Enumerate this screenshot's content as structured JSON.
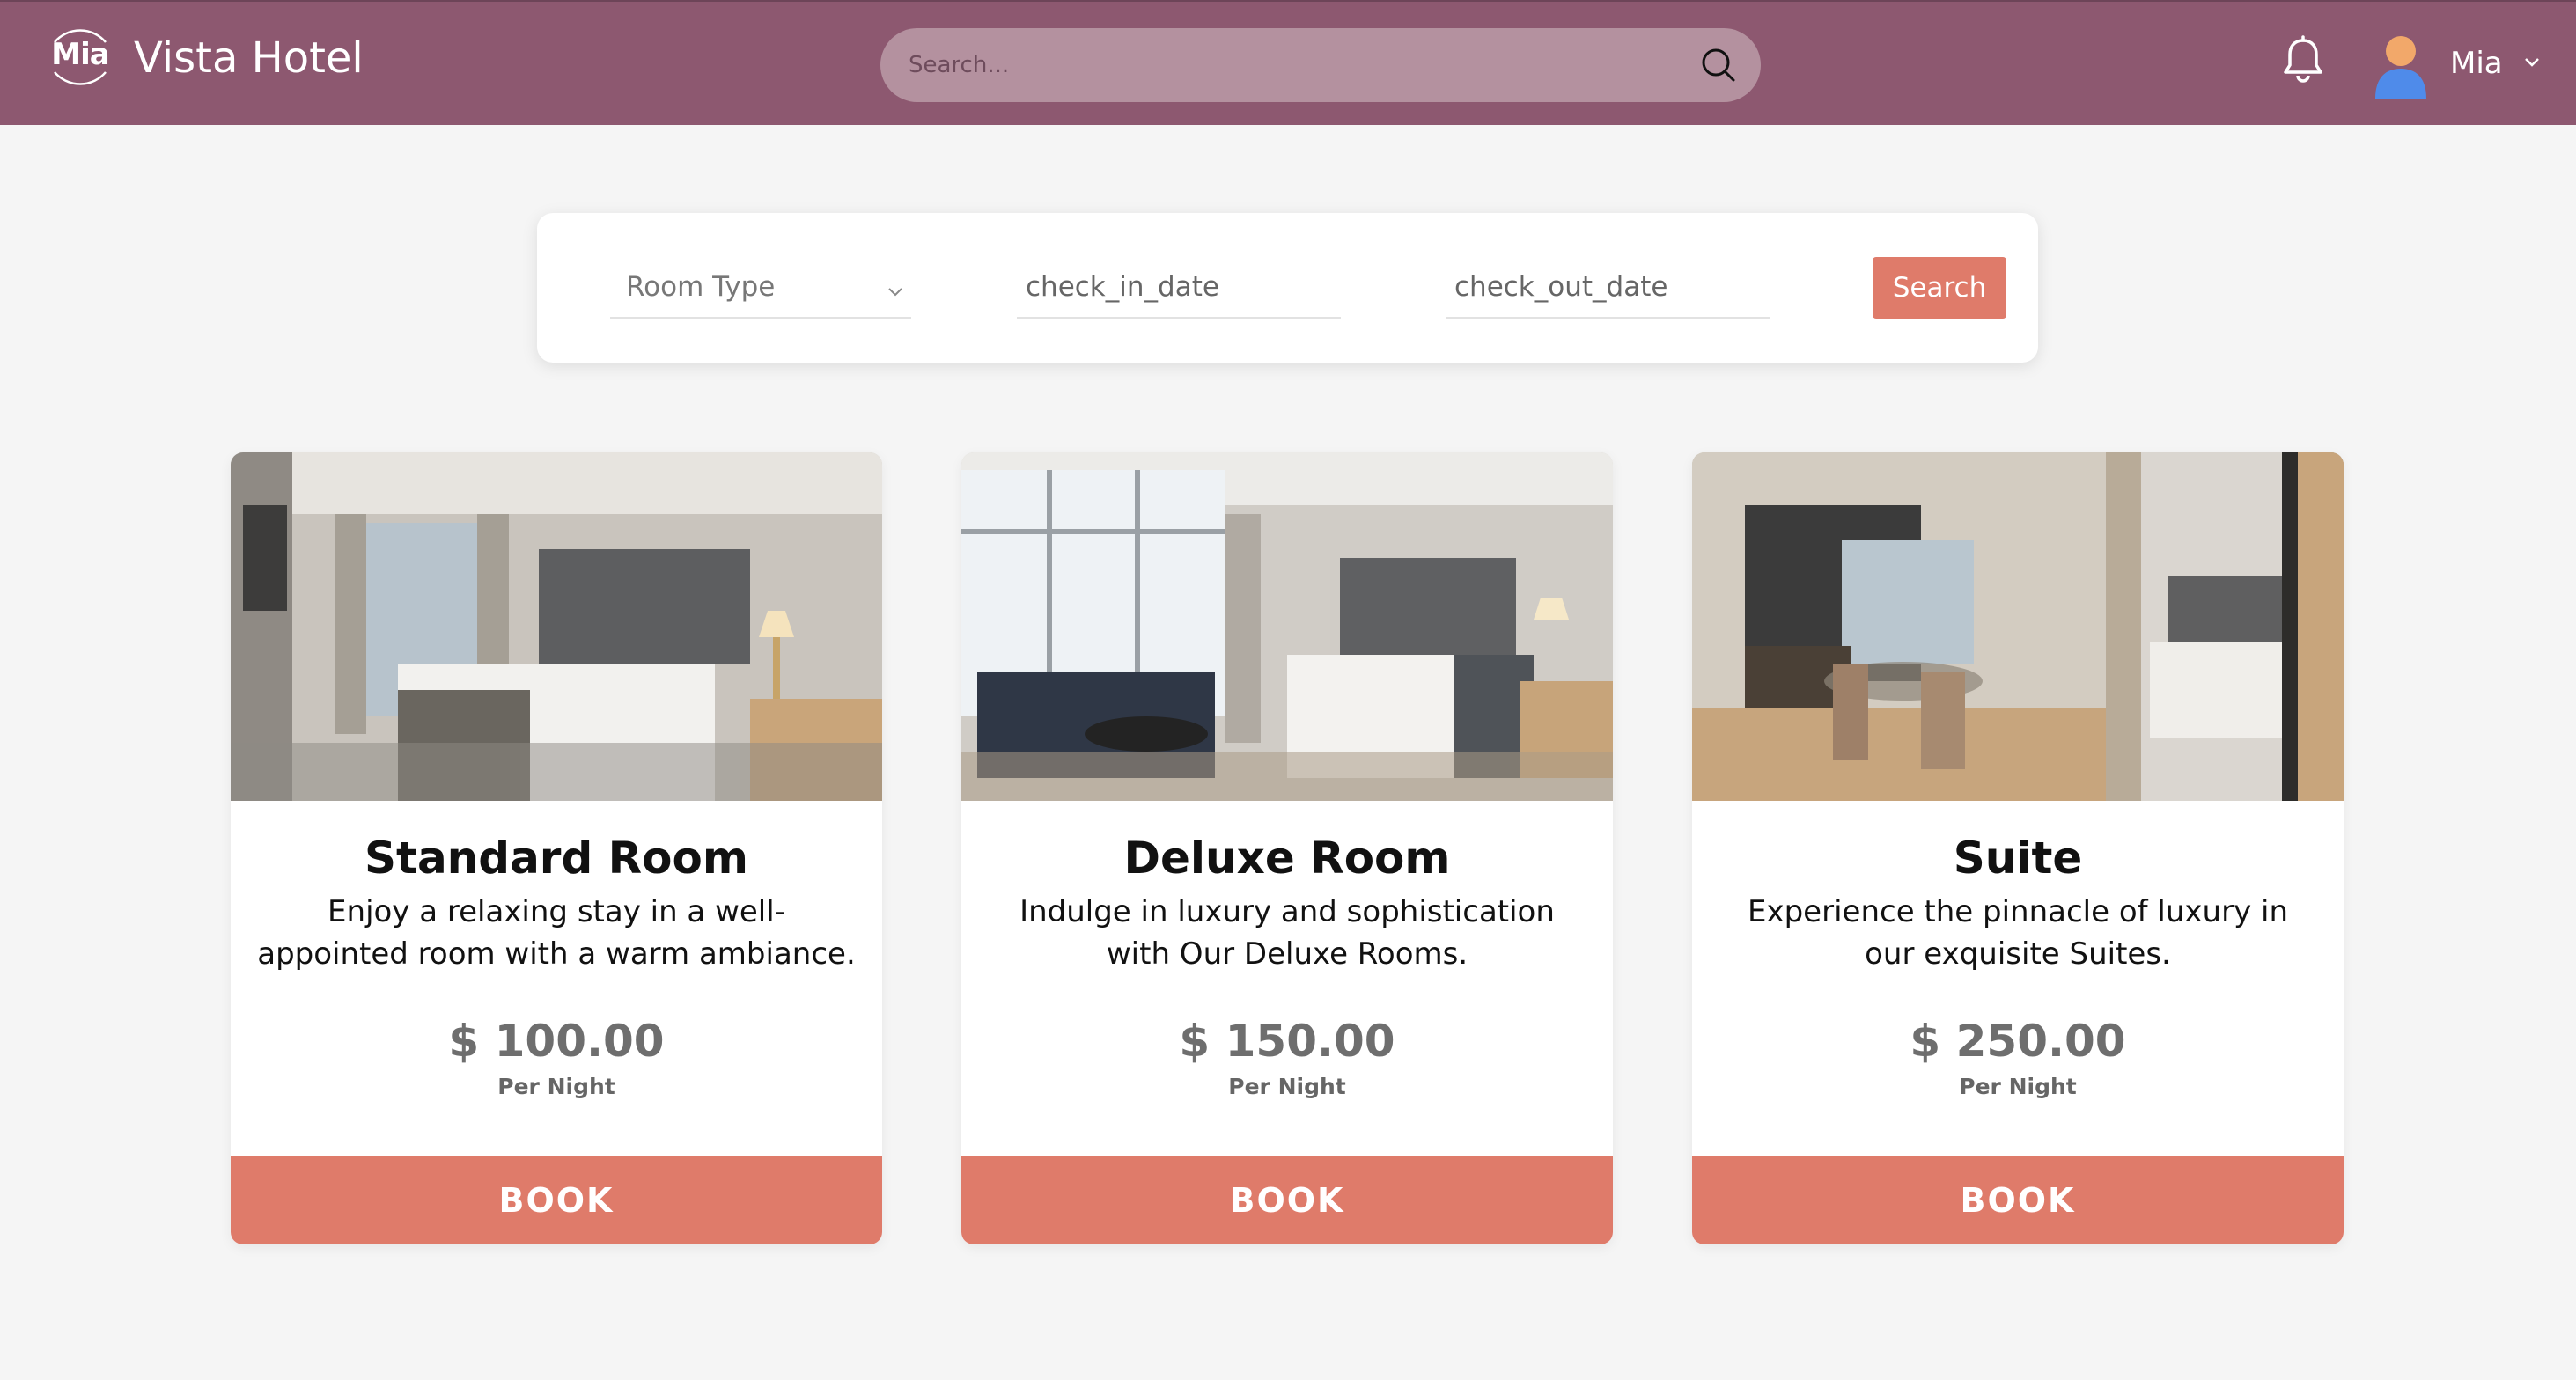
{
  "header": {
    "logo_text": "Mia",
    "title": "Vista Hotel",
    "search_placeholder": "Search...",
    "user_name": "Mia",
    "colors": {
      "bar": "#8d5870",
      "search_bg": "#b4919f"
    },
    "icons": [
      "search-icon",
      "bell-icon",
      "avatar",
      "chevron-down-icon"
    ]
  },
  "filter": {
    "room_type": "Room Type",
    "check_in": "check_in_date",
    "check_out": "check_out_date",
    "search_label": "Search"
  },
  "rooms": [
    {
      "name": "Standard Room",
      "description": "Enjoy a relaxing stay in a well-appointed room with a warm ambiance.",
      "price": "$ 100.00",
      "unit": "Per Night",
      "book_label": "BOOK"
    },
    {
      "name": "Deluxe Room",
      "description": "Indulge in luxury and sophistication with Our Deluxe Rooms.",
      "price": "$ 150.00",
      "unit": "Per Night",
      "book_label": "BOOK"
    },
    {
      "name": "Suite",
      "description": "Experience the pinnacle of luxury in our exquisite Suites.",
      "price": "$ 250.00",
      "unit": "Per Night",
      "book_label": "BOOK"
    }
  ],
  "accent_color": "#df7b6a"
}
